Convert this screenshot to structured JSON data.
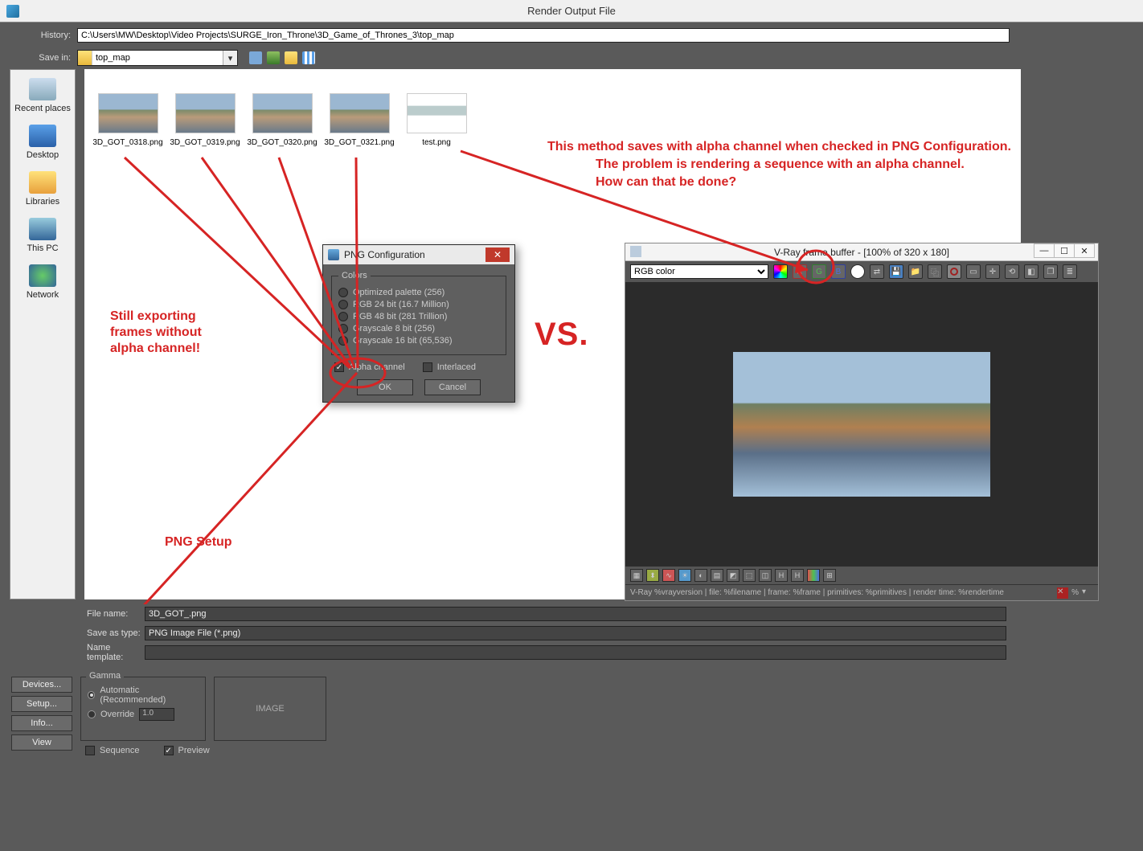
{
  "window": {
    "title": "Render Output File"
  },
  "history": {
    "label": "History:",
    "path": "C:\\Users\\MW\\Desktop\\Video Projects\\SURGE_Iron_Throne\\3D_Game_of_Thrones_3\\top_map"
  },
  "savein": {
    "label": "Save in:",
    "folder": "top_map"
  },
  "places": {
    "recent": "Recent places",
    "desktop": "Desktop",
    "libraries": "Libraries",
    "thispc": "This PC",
    "network": "Network"
  },
  "files": [
    "3D_GOT_0318.png",
    "3D_GOT_0319.png",
    "3D_GOT_0320.png",
    "3D_GOT_0321.png",
    "test.png"
  ],
  "bottom": {
    "filename_label": "File name:",
    "filename": "3D_GOT_.png",
    "saveastype_label": "Save as type:",
    "saveastype": "PNG Image File (*.png)",
    "nametemplate_label": "Name template:",
    "nametemplate": ""
  },
  "leftbtns": {
    "devices": "Devices...",
    "setup": "Setup...",
    "info": "Info...",
    "view": "View"
  },
  "gamma": {
    "legend": "Gamma",
    "auto": "Automatic (Recommended)",
    "override": "Override",
    "value": "1.0",
    "image": "IMAGE"
  },
  "seq": {
    "sequence": "Sequence",
    "preview": "Preview"
  },
  "png": {
    "title": "PNG Configuration",
    "colors_legend": "Colors",
    "opt_pal": "Optimized palette  (256)",
    "opt_24": "RGB 24 bit  (16.7 Million)",
    "opt_48": "RGB 48 bit  (281 Trillion)",
    "opt_g8": "Grayscale 8 bit  (256)",
    "opt_g16": "Grayscale 16 bit  (65,536)",
    "alpha": "Alpha channel",
    "interlaced": "Interlaced",
    "ok": "OK",
    "cancel": "Cancel"
  },
  "vfb": {
    "title": "V-Ray frame buffer - [100% of 320 x 180]",
    "channel": "RGB color",
    "status": "V-Ray %vrayversion | file: %filename | frame: %frame | primitives: %primitives | render time: %rendertime",
    "pct": "%"
  },
  "anno": {
    "left1": "Still exporting",
    "left2": "frames without",
    "left3": "alpha channel!",
    "pngsetup": "PNG Setup",
    "vs": "VS.",
    "right1": "This method saves with alpha channel when checked in PNG Configuration.",
    "right2": "The problem is rendering a sequence with an alpha channel.",
    "right3": "How can that be done?"
  }
}
